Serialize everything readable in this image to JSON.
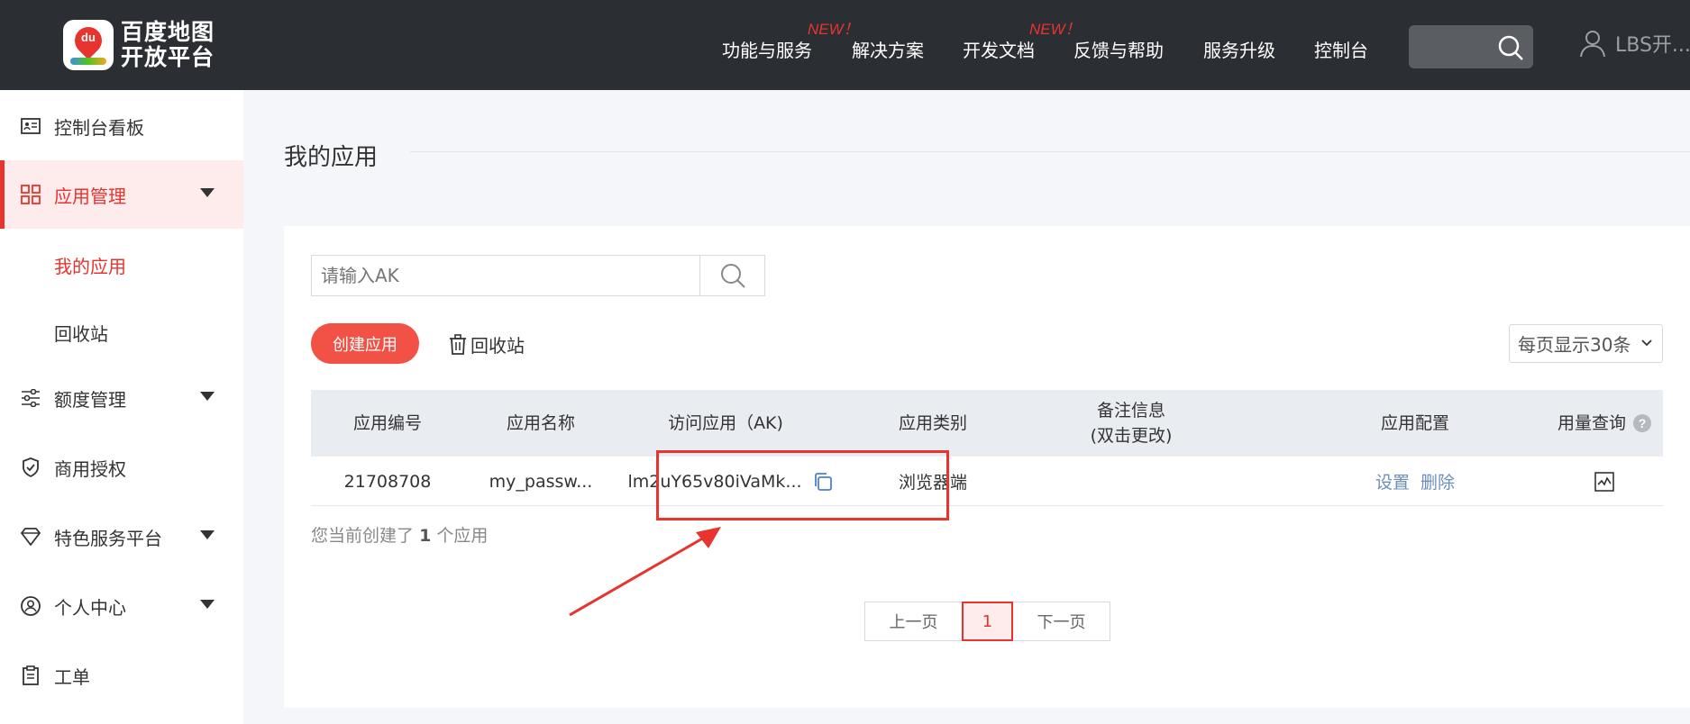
{
  "header": {
    "logo_text": "百度地图开放平台",
    "logo_badge": "du",
    "nav": [
      {
        "label": "功能与服务",
        "new": true
      },
      {
        "label": "解决方案",
        "new": false
      },
      {
        "label": "开发文档",
        "new": true
      },
      {
        "label": "反馈与帮助",
        "new": false
      },
      {
        "label": "服务升级",
        "new": false
      },
      {
        "label": "控制台",
        "new": false
      }
    ],
    "new_badge": "NEW！",
    "user_name": "LBS开..."
  },
  "sidebar": {
    "items": [
      {
        "label": "控制台看板",
        "icon": "dashboard-icon"
      },
      {
        "label": "应用管理",
        "icon": "grid-icon",
        "active": true,
        "expandable": true
      },
      {
        "label": "额度管理",
        "icon": "sliders-icon",
        "expandable": true
      },
      {
        "label": "商用授权",
        "icon": "shield-check-icon"
      },
      {
        "label": "特色服务平台",
        "icon": "gem-icon",
        "expandable": true
      },
      {
        "label": "个人中心",
        "icon": "user-circle-icon",
        "expandable": true
      },
      {
        "label": "工单",
        "icon": "clipboard-icon"
      }
    ],
    "subitems": [
      {
        "label": "我的应用",
        "active": true
      },
      {
        "label": "回收站",
        "active": false
      }
    ]
  },
  "main": {
    "title": "我的应用",
    "search_placeholder": "请输入AK",
    "create_button": "创建应用",
    "recycle_link": "回收站",
    "per_page": "每页显示30条",
    "table": {
      "headers": [
        "应用编号",
        "应用名称",
        "访问应用（AK)",
        "应用类别",
        "备注信息\n(双击更改)",
        "应用配置",
        "用量查询"
      ],
      "rows": [
        {
          "id": "21708708",
          "name": "my_passw...",
          "ak": "lm2uY65v80iVaMk...",
          "category": "浏览器端",
          "note": "",
          "config_set": "设置",
          "config_delete": "删除"
        }
      ]
    },
    "summary_prefix": "您当前创建了",
    "summary_count": "1",
    "summary_suffix": "个应用",
    "pager": {
      "prev": "上一页",
      "current": "1",
      "next": "下一页"
    }
  },
  "colors": {
    "accent": "#e8342e",
    "header_bg": "#2b2e33",
    "link": "#6c8ebf"
  }
}
